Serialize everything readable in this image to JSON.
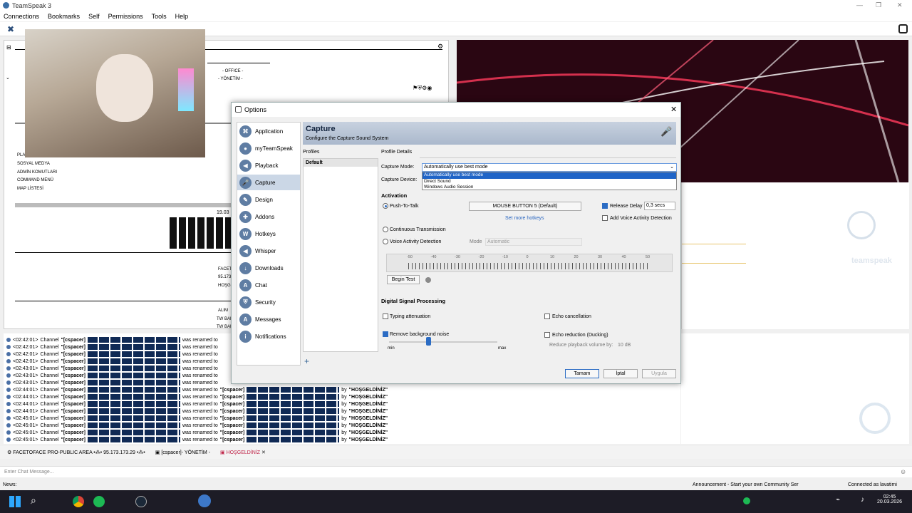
{
  "window": {
    "title": "TeamSpeak 3"
  },
  "menu": [
    "Connections",
    "Bookmarks",
    "Self",
    "Permissions",
    "Tools",
    "Help"
  ],
  "tree": {
    "items": [
      "- OFFICE -",
      "- YÖNETİM -",
      "PLAYER DİSİPLİNİ",
      "SOSYAL MEDYA",
      "ADMİN KOMUTLARI",
      "COMMAND MENÜ",
      "MAP LİSTESİ"
    ],
    "date_fragment": "19.03",
    "server_lines": [
      "FACETO",
      "95.173.",
      "HOŞGE"
    ],
    "lower": [
      "ALIM",
      "TW BAKMA",
      "TW BAKMA"
    ]
  },
  "dialog": {
    "title": "Options",
    "nav": [
      {
        "label": "Application",
        "icon": "application-icon"
      },
      {
        "label": "myTeamSpeak",
        "icon": "myteamspeak-icon"
      },
      {
        "label": "Playback",
        "icon": "speaker-icon"
      },
      {
        "label": "Capture",
        "icon": "microphone-icon",
        "selected": true
      },
      {
        "label": "Design",
        "icon": "design-icon"
      },
      {
        "label": "Addons",
        "icon": "puzzle-icon"
      },
      {
        "label": "Hotkeys",
        "icon": "keyboard-icon"
      },
      {
        "label": "Whisper",
        "icon": "whisper-icon"
      },
      {
        "label": "Downloads",
        "icon": "download-icon"
      },
      {
        "label": "Chat",
        "icon": "chat-icon"
      },
      {
        "label": "Security",
        "icon": "shield-icon"
      },
      {
        "label": "Messages",
        "icon": "messages-icon"
      },
      {
        "label": "Notifications",
        "icon": "info-icon"
      }
    ],
    "header": {
      "title": "Capture",
      "subtitle": "Configure the Capture Sound System"
    },
    "profiles_label": "Profiles",
    "profiles": [
      "Default"
    ],
    "profile_details_label": "Profile Details",
    "capture_mode_label": "Capture Mode:",
    "capture_mode_value": "Automatically use best mode",
    "capture_mode_options": [
      "Automatically use best mode",
      "Direct Sound",
      "Windows Audio Session"
    ],
    "capture_device_label": "Capture Device:",
    "activation_label": "Activation",
    "push_to_talk": "Push-To-Talk",
    "hotkey": "MOUSE BUTTON 5 (Default)",
    "set_more_hotkeys": "Set more hotkeys",
    "release_delay_label": "Release Delay",
    "release_delay_value": "0,3 secs",
    "add_vad": "Add Voice Activity Detection",
    "continuous": "Continuous Transmission",
    "vad": "Voice Activity Detection",
    "mode_label": "Mode",
    "mode_value": "Automatic",
    "meter_ticks": [
      "-50",
      "-40",
      "-30",
      "-20",
      "-10",
      "0",
      "10",
      "20",
      "30",
      "40",
      "50"
    ],
    "begin_test": "Begin Test",
    "dsp_label": "Digital Signal Processing",
    "typing_attenuation": "Typing attenuation",
    "echo_cancellation": "Echo cancellation",
    "remove_noise": "Remove background noise",
    "echo_reduction": "Echo reduction (Ducking)",
    "reduce_playback_label": "Reduce playback volume by:",
    "reduce_playback_value": "10 dB",
    "slider_min": "min",
    "slider_max": "max",
    "ok": "Tamam",
    "cancel": "İptal",
    "apply": "Uygula"
  },
  "chat_log": [
    {
      "time": "<02:42:01>",
      "pre": "Channel",
      "name": "\"[cspacer]",
      "mid": "was renamed to",
      "to": "",
      "by": "",
      "user": ""
    },
    {
      "time": "<02:42:01>",
      "pre": "Channel",
      "name": "\"[cspacer]",
      "mid": "was renamed to",
      "to": "",
      "by": "",
      "user": ""
    },
    {
      "time": "<02:42:01>",
      "pre": "Channel",
      "name": "\"[cspacer]",
      "mid": "was renamed to",
      "to": "",
      "by": "",
      "user": ""
    },
    {
      "time": "<02:42:01>",
      "pre": "Channel",
      "name": "\"[cspacer]",
      "mid": "was renamed to",
      "to": "",
      "by": "",
      "user": ""
    },
    {
      "time": "<02:43:01>",
      "pre": "Channel",
      "name": "\"[cspacer]",
      "mid": "was renamed to",
      "to": "",
      "by": "",
      "user": ""
    },
    {
      "time": "<02:43:01>",
      "pre": "Channel",
      "name": "\"[cspacer]",
      "mid": "was renamed to",
      "to": "",
      "by": "",
      "user": ""
    },
    {
      "time": "<02:43:01>",
      "pre": "Channel",
      "name": "\"[cspacer]",
      "mid": "was renamed to",
      "to": "",
      "by": "",
      "user": ""
    },
    {
      "time": "<02:44:01>",
      "pre": "Channel",
      "name": "\"[cspacer]",
      "mid": "was renamed to",
      "to": "\"[cspacer]",
      "by": "by",
      "user": "\"HOŞGELDİNİZ\""
    },
    {
      "time": "<02:44:01>",
      "pre": "Channel",
      "name": "\"[cspacer]",
      "mid": "was renamed to",
      "to": "\"[cspacer]",
      "by": "by",
      "user": "\"HOŞGELDİNİZ\""
    },
    {
      "time": "<02:44:01>",
      "pre": "Channel",
      "name": "\"[cspacer]",
      "mid": "was renamed to",
      "to": "\"[cspacer]",
      "by": "by",
      "user": "\"HOŞGELDİNİZ\""
    },
    {
      "time": "<02:44:01>",
      "pre": "Channel",
      "name": "\"[cspacer]",
      "mid": "was renamed to",
      "to": "\"[cspacer]",
      "by": "by",
      "user": "\"HOŞGELDİNİZ\""
    },
    {
      "time": "<02:45:01>",
      "pre": "Channel",
      "name": "\"[cspacer]",
      "mid": "was renamed to",
      "to": "\"[cspacer]",
      "by": "by",
      "user": "\"HOŞGELDİNİZ\""
    },
    {
      "time": "<02:45:01>",
      "pre": "Channel",
      "name": "\"[cspacer]",
      "mid": "was renamed to",
      "to": "\"[cspacer]",
      "by": "by",
      "user": "\"HOŞGELDİNİZ\""
    },
    {
      "time": "<02:45:01>",
      "pre": "Channel",
      "name": "\"[cspacer]",
      "mid": "was renamed to",
      "to": "\"[cspacer]",
      "by": "by",
      "user": "\"HOŞGELDİNİZ\""
    },
    {
      "time": "<02:45:01>",
      "pre": "Channel",
      "name": "\"[cspacer]",
      "mid": "was renamed to",
      "to": "\"[cspacer]",
      "by": "by",
      "user": "\"HOŞGELDİNİZ\""
    }
  ],
  "tabs": [
    {
      "label": "FACETOFACE PRO-PUBLIC AREA •⁂• 95.173.173.29 •⁂•"
    },
    {
      "label": "[cspacer]- YÖNETİM -"
    },
    {
      "label": "HOŞGELDİNİZ"
    }
  ],
  "chat_input_placeholder": "Enter Chat Message...",
  "status": {
    "news": "News:",
    "announcement": "Announcement - Start your own Community Ser",
    "connected": "Connected as lavatimi"
  },
  "taskbar": {
    "time": "02:45",
    "date": "20.03.2026"
  },
  "banner": {
    "watermark": "teamspeak"
  }
}
